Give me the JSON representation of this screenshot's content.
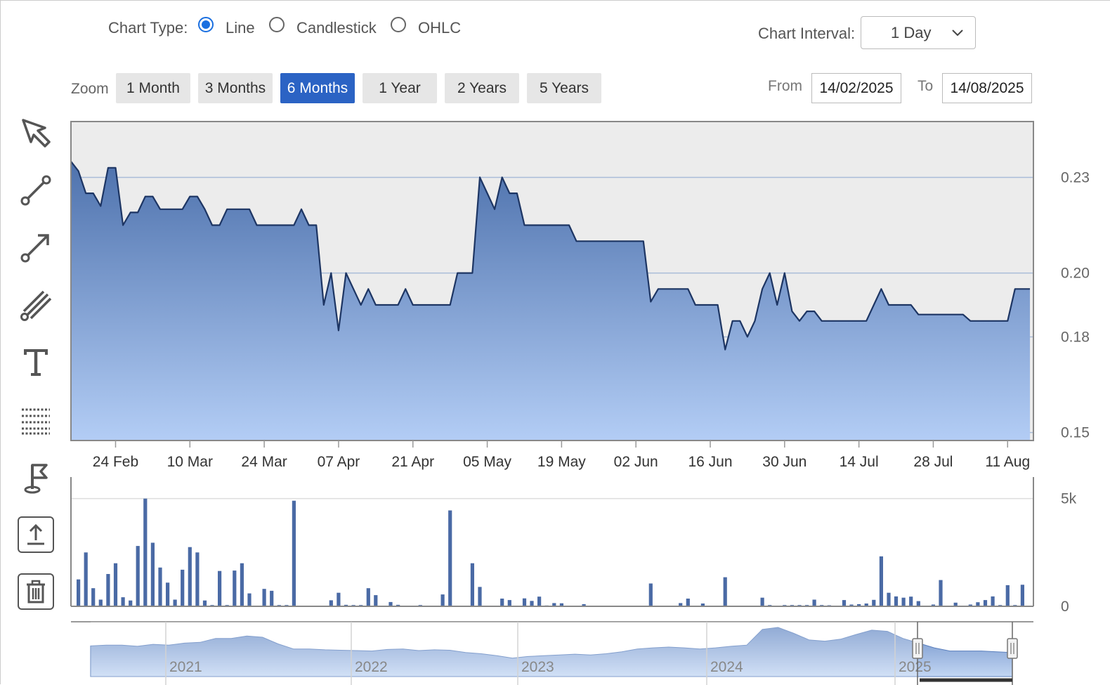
{
  "controls": {
    "chart_type_label": "Chart Type:",
    "chart_types": [
      {
        "label": "Line",
        "selected": true
      },
      {
        "label": "Candlestick",
        "selected": false
      },
      {
        "label": "OHLC",
        "selected": false
      }
    ],
    "interval_label": "Chart Interval:",
    "interval_value": "1 Day",
    "zoom_label": "Zoom",
    "zoom_buttons": [
      {
        "label": "1 Month",
        "active": false
      },
      {
        "label": "3 Months",
        "active": false
      },
      {
        "label": "6 Months",
        "active": true
      },
      {
        "label": "1 Year",
        "active": false
      },
      {
        "label": "2 Years",
        "active": false
      },
      {
        "label": "5 Years",
        "active": false
      }
    ],
    "from_label": "From",
    "from_value": "14/02/2025",
    "to_label": "To",
    "to_value": "14/08/2025"
  },
  "toolbar": {
    "icons": [
      "cursor-icon",
      "line-segment-icon",
      "arrow-line-icon",
      "parallel-lines-icon",
      "text-icon",
      "grid-icon",
      "flag-icon",
      "upload-icon",
      "trash-icon"
    ]
  },
  "colors": {
    "line": "#1d3563",
    "area_top": "#4e72ad",
    "area_bottom": "#b3cdf5",
    "plot_bg": "#ececec",
    "volume_bar": "#4a6aa5",
    "active_button": "#2b63c4",
    "radio_selected": "#1a6fe0"
  },
  "chart_data": [
    {
      "type": "area",
      "x": [
        "14 Feb",
        "17 Feb",
        "18 Feb",
        "19 Feb",
        "20 Feb",
        "21 Feb",
        "24 Feb",
        "25 Feb",
        "26 Feb",
        "27 Feb",
        "28 Feb",
        "03 Mar",
        "04 Mar",
        "05 Mar",
        "06 Mar",
        "07 Mar",
        "10 Mar",
        "11 Mar",
        "12 Mar",
        "13 Mar",
        "14 Mar",
        "17 Mar",
        "18 Mar",
        "19 Mar",
        "20 Mar",
        "21 Mar",
        "24 Mar",
        "25 Mar",
        "26 Mar",
        "27 Mar",
        "28 Mar",
        "31 Mar",
        "01 Apr",
        "02 Apr",
        "03 Apr",
        "04 Apr",
        "07 Apr",
        "08 Apr",
        "09 Apr",
        "10 Apr",
        "11 Apr",
        "14 Apr",
        "15 Apr",
        "16 Apr",
        "17 Apr",
        "18 Apr",
        "21 Apr",
        "22 Apr",
        "23 Apr",
        "24 Apr",
        "25 Apr",
        "28 Apr",
        "29 Apr",
        "30 Apr",
        "01 May",
        "02 May",
        "05 May",
        "06 May",
        "07 May",
        "08 May",
        "09 May",
        "12 May",
        "13 May",
        "14 May",
        "15 May",
        "16 May",
        "19 May",
        "20 May",
        "21 May",
        "22 May",
        "23 May",
        "26 May",
        "27 May",
        "28 May",
        "29 May",
        "30 May",
        "02 Jun",
        "03 Jun",
        "04 Jun",
        "05 Jun",
        "06 Jun",
        "09 Jun",
        "10 Jun",
        "11 Jun",
        "12 Jun",
        "13 Jun",
        "16 Jun",
        "17 Jun",
        "18 Jun",
        "19 Jun",
        "20 Jun",
        "23 Jun",
        "24 Jun",
        "25 Jun",
        "26 Jun",
        "27 Jun",
        "30 Jun",
        "01 Jul",
        "02 Jul",
        "03 Jul",
        "04 Jul",
        "07 Jul",
        "08 Jul",
        "09 Jul",
        "10 Jul",
        "11 Jul",
        "14 Jul",
        "15 Jul",
        "16 Jul",
        "17 Jul",
        "18 Jul",
        "21 Jul",
        "22 Jul",
        "23 Jul",
        "24 Jul",
        "25 Jul",
        "28 Jul",
        "29 Jul",
        "30 Jul",
        "31 Jul",
        "01 Aug",
        "04 Aug",
        "05 Aug",
        "06 Aug",
        "07 Aug",
        "08 Aug",
        "11 Aug",
        "12 Aug",
        "13 Aug",
        "14 Aug"
      ],
      "series": [
        {
          "values": [
            0.235,
            0.232,
            0.225,
            0.225,
            0.221,
            0.233,
            0.233,
            0.215,
            0.219,
            0.219,
            0.224,
            0.224,
            0.22,
            0.22,
            0.22,
            0.22,
            0.224,
            0.224,
            0.22,
            0.215,
            0.215,
            0.22,
            0.22,
            0.22,
            0.22,
            0.215,
            0.215,
            0.215,
            0.215,
            0.215,
            0.215,
            0.22,
            0.215,
            0.215,
            0.19,
            0.2,
            0.182,
            0.2,
            0.195,
            0.19,
            0.195,
            0.19,
            0.19,
            0.19,
            0.19,
            0.195,
            0.19,
            0.19,
            0.19,
            0.19,
            0.19,
            0.19,
            0.2,
            0.2,
            0.2,
            0.23,
            0.225,
            0.22,
            0.23,
            0.225,
            0.225,
            0.215,
            0.215,
            0.215,
            0.215,
            0.215,
            0.215,
            0.215,
            0.21,
            0.21,
            0.21,
            0.21,
            0.21,
            0.21,
            0.21,
            0.21,
            0.21,
            0.21,
            0.191,
            0.195,
            0.195,
            0.195,
            0.195,
            0.195,
            0.19,
            0.19,
            0.19,
            0.19,
            0.176,
            0.185,
            0.185,
            0.18,
            0.185,
            0.195,
            0.2,
            0.19,
            0.2,
            0.188,
            0.185,
            0.188,
            0.188,
            0.185,
            0.185,
            0.185,
            0.185,
            0.185,
            0.185,
            0.185,
            0.19,
            0.195,
            0.19,
            0.19,
            0.19,
            0.19,
            0.187,
            0.187,
            0.187,
            0.187,
            0.187,
            0.187,
            0.187,
            0.185,
            0.185,
            0.185,
            0.185,
            0.185,
            0.185,
            0.195,
            0.195,
            0.195
          ]
        }
      ],
      "ylim": [
        0.1475,
        0.2475
      ],
      "yticks": [
        "0.23",
        "0.20",
        "0.18",
        "0.15"
      ],
      "xticks": [
        "24 Feb",
        "10 Mar",
        "24 Mar",
        "07 Apr",
        "21 Apr",
        "05 May",
        "19 May",
        "02 Jun",
        "16 Jun",
        "30 Jun",
        "14 Jul",
        "28 Jul",
        "11 Aug"
      ],
      "grid": true
    },
    {
      "type": "bar",
      "x": [
        "17 Feb",
        "18 Feb",
        "19 Feb",
        "20 Feb",
        "21 Feb",
        "24 Feb",
        "25 Feb",
        "26 Feb",
        "27 Feb",
        "28 Feb",
        "03 Mar",
        "04 Mar",
        "05 Mar",
        "06 Mar",
        "07 Mar",
        "10 Mar",
        "11 Mar",
        "12 Mar",
        "13 Mar",
        "14 Mar",
        "17 Mar",
        "18 Mar",
        "19 Mar",
        "20 Mar",
        "24 Mar",
        "25 Mar",
        "26 Mar",
        "27 Mar",
        "28 Mar",
        "04 Apr",
        "07 Apr",
        "08 Apr",
        "09 Apr",
        "10 Apr",
        "11 Apr",
        "14 Apr",
        "16 Apr",
        "17 Apr",
        "22 Apr",
        "25 Apr",
        "28 Apr",
        "01 May",
        "02 May",
        "07 May",
        "08 May",
        "12 May",
        "13 May",
        "14 May",
        "15 May",
        "16 May",
        "19 May",
        "22 May",
        "04 Jun",
        "10 Jun",
        "11 Jun",
        "13 Jun",
        "18 Jun",
        "25 Jun",
        "26 Jun",
        "30 Jun",
        "01 Jul",
        "02 Jul",
        "03 Jul",
        "04 Jul",
        "07 Jul",
        "08 Jul",
        "10 Jul",
        "11 Jul",
        "14 Jul",
        "15 Jul",
        "16 Jul",
        "17 Jul",
        "18 Jul",
        "21 Jul",
        "22 Jul",
        "23 Jul",
        "24 Jul",
        "28 Jul",
        "29 Jul",
        "31 Jul",
        "04 Aug",
        "05 Aug",
        "06 Aug",
        "07 Aug",
        "08 Aug",
        "11 Aug",
        "12 Aug",
        "13 Aug"
      ],
      "values": [
        1250,
        2500,
        840,
        310,
        1500,
        2000,
        420,
        270,
        2800,
        5000,
        2950,
        1800,
        1100,
        310,
        1700,
        2750,
        2500,
        270,
        60,
        1640,
        60,
        1660,
        2000,
        600,
        810,
        720,
        60,
        60,
        4900,
        280,
        630,
        70,
        60,
        60,
        840,
        520,
        200,
        70,
        60,
        550,
        4450,
        2000,
        900,
        360,
        290,
        370,
        250,
        450,
        40,
        150,
        140,
        100,
        1060,
        150,
        360,
        130,
        1350,
        400,
        60,
        60,
        60,
        60,
        60,
        310,
        60,
        50,
        290,
        80,
        100,
        130,
        300,
        2320,
        630,
        460,
        400,
        450,
        240,
        80,
        1220,
        170,
        80,
        190,
        290,
        460,
        60,
        980,
        60,
        1000
      ],
      "ylim": [
        0,
        6000
      ],
      "yticks": [
        "5k",
        "0"
      ],
      "grid": true
    }
  ],
  "navigator": {
    "year_labels": [
      "2021",
      "2022",
      "2023",
      "2024",
      "2025"
    ],
    "values": [
      0.53,
      0.55,
      0.55,
      0.52,
      0.57,
      0.55,
      0.6,
      0.62,
      0.72,
      0.72,
      0.78,
      0.75,
      0.58,
      0.45,
      0.45,
      0.43,
      0.42,
      0.41,
      0.4,
      0.44,
      0.45,
      0.41,
      0.43,
      0.42,
      0.36,
      0.33,
      0.28,
      0.22,
      0.26,
      0.28,
      0.3,
      0.32,
      0.3,
      0.33,
      0.38,
      0.45,
      0.48,
      0.5,
      0.48,
      0.45,
      0.48,
      0.52,
      0.55,
      0.95,
      1.0,
      0.85,
      0.68,
      0.65,
      0.7,
      0.82,
      0.93,
      0.9,
      0.72,
      0.6,
      0.48,
      0.4,
      0.4,
      0.4,
      0.38,
      0.36
    ]
  }
}
